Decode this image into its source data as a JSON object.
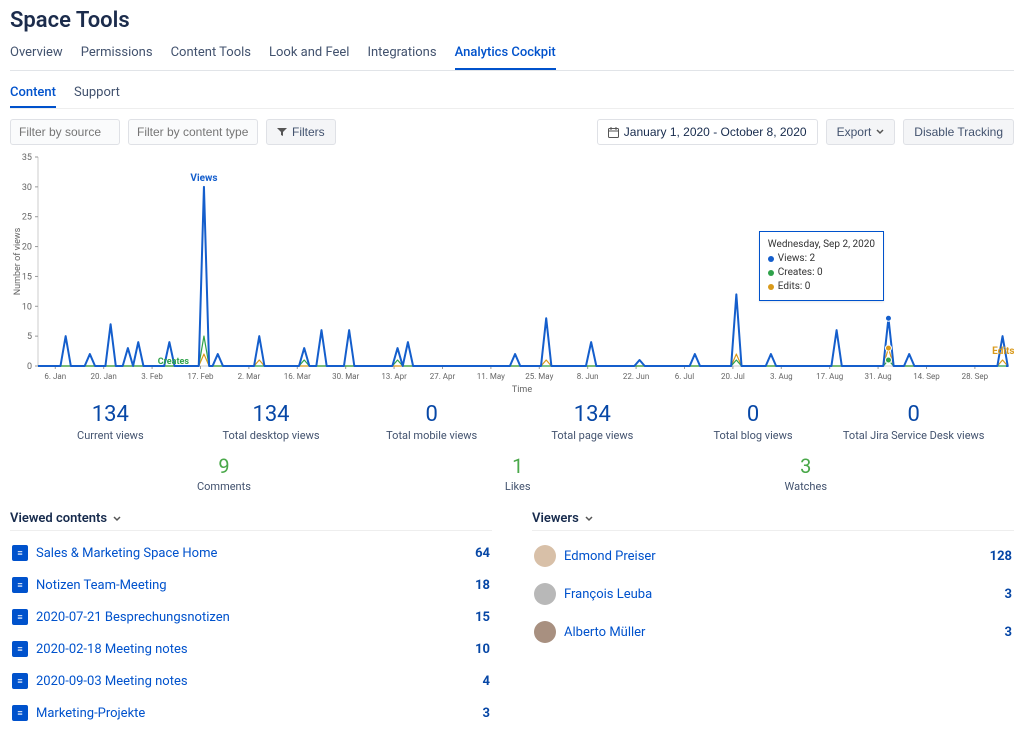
{
  "title": "Space Tools",
  "tabs": {
    "overview": "Overview",
    "permissions": "Permissions",
    "content_tools": "Content Tools",
    "look_feel": "Look and Feel",
    "integrations": "Integrations",
    "analytics": "Analytics Cockpit"
  },
  "subtabs": {
    "content": "Content",
    "support": "Support"
  },
  "filters": {
    "source_ph": "Filter by source",
    "type_ph": "Filter by content type",
    "filters_btn": "Filters",
    "date_range": "January 1, 2020 - October 8, 2020",
    "export": "Export",
    "disable": "Disable Tracking"
  },
  "chart": {
    "y_label": "Number of views",
    "x_label": "Time",
    "series_views": "Views",
    "series_creates": "Creates",
    "series_edits": "Edits",
    "tooltip_date": "Wednesday, Sep 2, 2020",
    "tooltip_views": "Views: 2",
    "tooltip_creates": "Creates: 0",
    "tooltip_edits": "Edits: 0"
  },
  "stats": {
    "current": {
      "val": "134",
      "lbl": "Current views"
    },
    "desktop": {
      "val": "134",
      "lbl": "Total desktop views"
    },
    "mobile": {
      "val": "0",
      "lbl": "Total mobile views"
    },
    "page": {
      "val": "134",
      "lbl": "Total page views"
    },
    "blog": {
      "val": "0",
      "lbl": "Total blog views"
    },
    "jsd": {
      "val": "0",
      "lbl": "Total Jira Service Desk views"
    }
  },
  "engage": {
    "comments": {
      "val": "9",
      "lbl": "Comments"
    },
    "likes": {
      "val": "1",
      "lbl": "Likes"
    },
    "watches": {
      "val": "3",
      "lbl": "Watches"
    }
  },
  "viewed_head": "Viewed contents",
  "viewers_head": "Viewers",
  "viewed": [
    {
      "title": "Sales & Marketing Space Home",
      "count": "64"
    },
    {
      "title": "Notizen Team-Meeting",
      "count": "18"
    },
    {
      "title": "2020-07-21 Besprechungsnotizen",
      "count": "15"
    },
    {
      "title": "2020-02-18 Meeting notes",
      "count": "10"
    },
    {
      "title": "2020-09-03 Meeting notes",
      "count": "4"
    },
    {
      "title": "Marketing-Projekte",
      "count": "3"
    }
  ],
  "viewers": [
    {
      "name": "Edmond Preiser",
      "count": "128"
    },
    {
      "name": "François Leuba",
      "count": "3"
    },
    {
      "name": "Alberto Müller",
      "count": "3"
    }
  ],
  "chart_data": {
    "type": "line",
    "xlabel": "Time",
    "ylabel": "Number of views",
    "ylim": [
      0,
      35
    ],
    "yticks": [
      0,
      5,
      10,
      15,
      20,
      25,
      30,
      35
    ],
    "xticks": [
      "6. Jan",
      "20. Jan",
      "3. Feb",
      "17. Feb",
      "2. Mar",
      "16. Mar",
      "30. Mar",
      "13. Apr",
      "27. Apr",
      "11. May",
      "25. May",
      "8. Jun",
      "22. Jun",
      "6. Jul",
      "20. Jul",
      "3. Aug",
      "17. Aug",
      "31. Aug",
      "14. Sep",
      "28. Sep"
    ],
    "x_span_days": 280,
    "series": [
      {
        "name": "Views",
        "color": "#145ecc",
        "peaks": [
          {
            "day": 8,
            "value": 5
          },
          {
            "day": 15,
            "value": 2
          },
          {
            "day": 21,
            "value": 7
          },
          {
            "day": 26,
            "value": 3
          },
          {
            "day": 29,
            "value": 4
          },
          {
            "day": 38,
            "value": 4
          },
          {
            "day": 48,
            "value": 30
          },
          {
            "day": 52,
            "value": 2
          },
          {
            "day": 64,
            "value": 5
          },
          {
            "day": 77,
            "value": 3
          },
          {
            "day": 82,
            "value": 6
          },
          {
            "day": 90,
            "value": 6
          },
          {
            "day": 104,
            "value": 3
          },
          {
            "day": 107,
            "value": 4
          },
          {
            "day": 138,
            "value": 2
          },
          {
            "day": 147,
            "value": 8
          },
          {
            "day": 160,
            "value": 4
          },
          {
            "day": 174,
            "value": 1
          },
          {
            "day": 190,
            "value": 2
          },
          {
            "day": 202,
            "value": 12
          },
          {
            "day": 212,
            "value": 2
          },
          {
            "day": 231,
            "value": 6
          },
          {
            "day": 246,
            "value": 8
          },
          {
            "day": 252,
            "value": 2
          },
          {
            "day": 279,
            "value": 5
          }
        ]
      },
      {
        "name": "Creates",
        "color": "#2fa24a",
        "peaks": [
          {
            "day": 48,
            "value": 5
          },
          {
            "day": 77,
            "value": 1
          },
          {
            "day": 104,
            "value": 1
          },
          {
            "day": 202,
            "value": 1
          },
          {
            "day": 246,
            "value": 1
          }
        ]
      },
      {
        "name": "Edits",
        "color": "#d99a1b",
        "peaks": [
          {
            "day": 48,
            "value": 2
          },
          {
            "day": 64,
            "value": 1
          },
          {
            "day": 147,
            "value": 1
          },
          {
            "day": 202,
            "value": 2
          },
          {
            "day": 246,
            "value": 3
          },
          {
            "day": 279,
            "value": 1
          }
        ]
      }
    ]
  }
}
